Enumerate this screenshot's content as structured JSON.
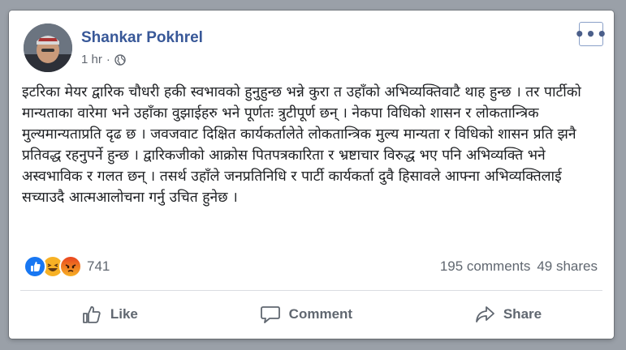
{
  "post": {
    "author": "Shankar Pokhrel",
    "time": "1 hr",
    "separator": "·",
    "privacy_icon": "globe-icon",
    "more_label": "•••",
    "body": "इटरिका मेयर द्वारिक चौधरी हकी स्वभावको हुनुहुन्छ भन्ने कुरा त उहाँको अभिव्यक्तिवाटै थाह हुन्छ । तर पार्टीको मान्यताका वारेमा भने उहाँका वुझाईहरु भने पूर्णतः त्रुटीपूर्ण छन् । नेकपा विधिको शासन र लोकतान्त्रिक मुल्यमान्यताप्रति दृढ छ । जवजवाट दिक्षित कार्यकर्तालेते लोकतान्त्रिक मुल्य मान्यता र विधिको शासन प्रति झनै प्रतिवद्ध रहनुपर्ने हुन्छ । द्वारिकजीको आक्रोस पितपत्रकारिता र भ्रष्टाचार विरुद्ध भए पनि अभिव्यक्ति भने अस्वभाविक र गलत छन् । तसर्थ उहाँले जनप्रतिनिधि र पार्टी कार्यकर्ता दुवै हिसावले आफ्ना अभिव्यक्तिलाई सच्याउदै आत्मआलोचना गर्नु उचित हुनेछ ।"
  },
  "reactions": {
    "icons": [
      "like-reaction-icon",
      "haha-reaction-icon",
      "angry-reaction-icon"
    ],
    "count": "741"
  },
  "stats": {
    "comments": "195 comments",
    "shares": "49 shares"
  },
  "actions": {
    "like": "Like",
    "comment": "Comment",
    "share": "Share"
  },
  "colors": {
    "author_blue": "#385898",
    "like_blue": "#1877f2",
    "haha_yellow": "#f7b125",
    "angry_orange": "#e9710f",
    "muted_gray": "#606770"
  }
}
